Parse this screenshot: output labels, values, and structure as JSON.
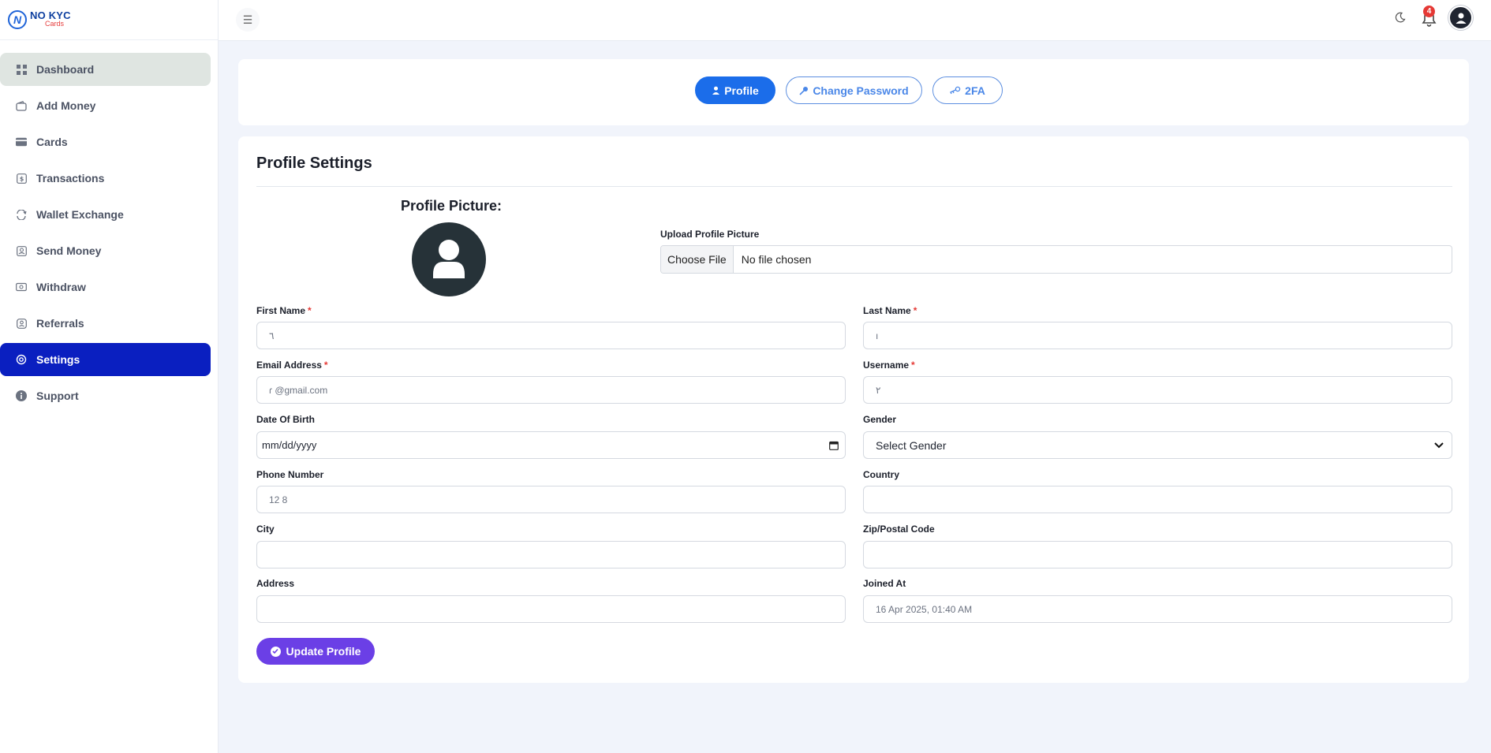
{
  "brand": {
    "name": "NO KYC",
    "sub": "Cards"
  },
  "sidebar": {
    "items": [
      {
        "label": "Dashboard",
        "icon": "dashboard-icon"
      },
      {
        "label": "Add Money",
        "icon": "wallet-icon"
      },
      {
        "label": "Cards",
        "icon": "card-icon"
      },
      {
        "label": "Transactions",
        "icon": "transactions-icon"
      },
      {
        "label": "Wallet Exchange",
        "icon": "exchange-icon"
      },
      {
        "label": "Send Money",
        "icon": "send-icon"
      },
      {
        "label": "Withdraw",
        "icon": "withdraw-icon"
      },
      {
        "label": "Referrals",
        "icon": "referral-icon"
      },
      {
        "label": "Settings",
        "icon": "settings-icon"
      },
      {
        "label": "Support",
        "icon": "info-icon"
      }
    ],
    "active": "Settings"
  },
  "header": {
    "notification_count": "4"
  },
  "tabs": {
    "profile": "Profile",
    "change_password": "Change Password",
    "twofa": "2FA"
  },
  "form": {
    "title": "Profile Settings",
    "profile_picture_label": "Profile Picture:",
    "upload_label": "Upload Profile Picture",
    "choose_file": "Choose File",
    "no_file": "No file chosen",
    "fields": {
      "first_name": {
        "label": "First Name",
        "value": "٦"
      },
      "last_name": {
        "label": "Last Name",
        "value": "ı"
      },
      "email": {
        "label": "Email Address",
        "value": "ɾ          @gmail.com"
      },
      "username": {
        "label": "Username",
        "value": "٢"
      },
      "dob": {
        "label": "Date Of Birth",
        "value": "mm/dd/yyyy"
      },
      "gender": {
        "label": "Gender",
        "value": "Select Gender"
      },
      "phone": {
        "label": "Phone Number",
        "value": "12      8"
      },
      "country": {
        "label": "Country",
        "value": ""
      },
      "city": {
        "label": "City",
        "value": ""
      },
      "zip": {
        "label": "Zip/Postal Code",
        "value": ""
      },
      "address": {
        "label": "Address",
        "value": ""
      },
      "joined": {
        "label": "Joined At",
        "value": "16 Apr 2025, 01:40 AM"
      }
    },
    "submit": "Update Profile"
  },
  "colors": {
    "primary": "#1b6dea",
    "active_nav": "#0a1fc0",
    "update_button": "#6b3fe6",
    "required": "#e53935"
  }
}
